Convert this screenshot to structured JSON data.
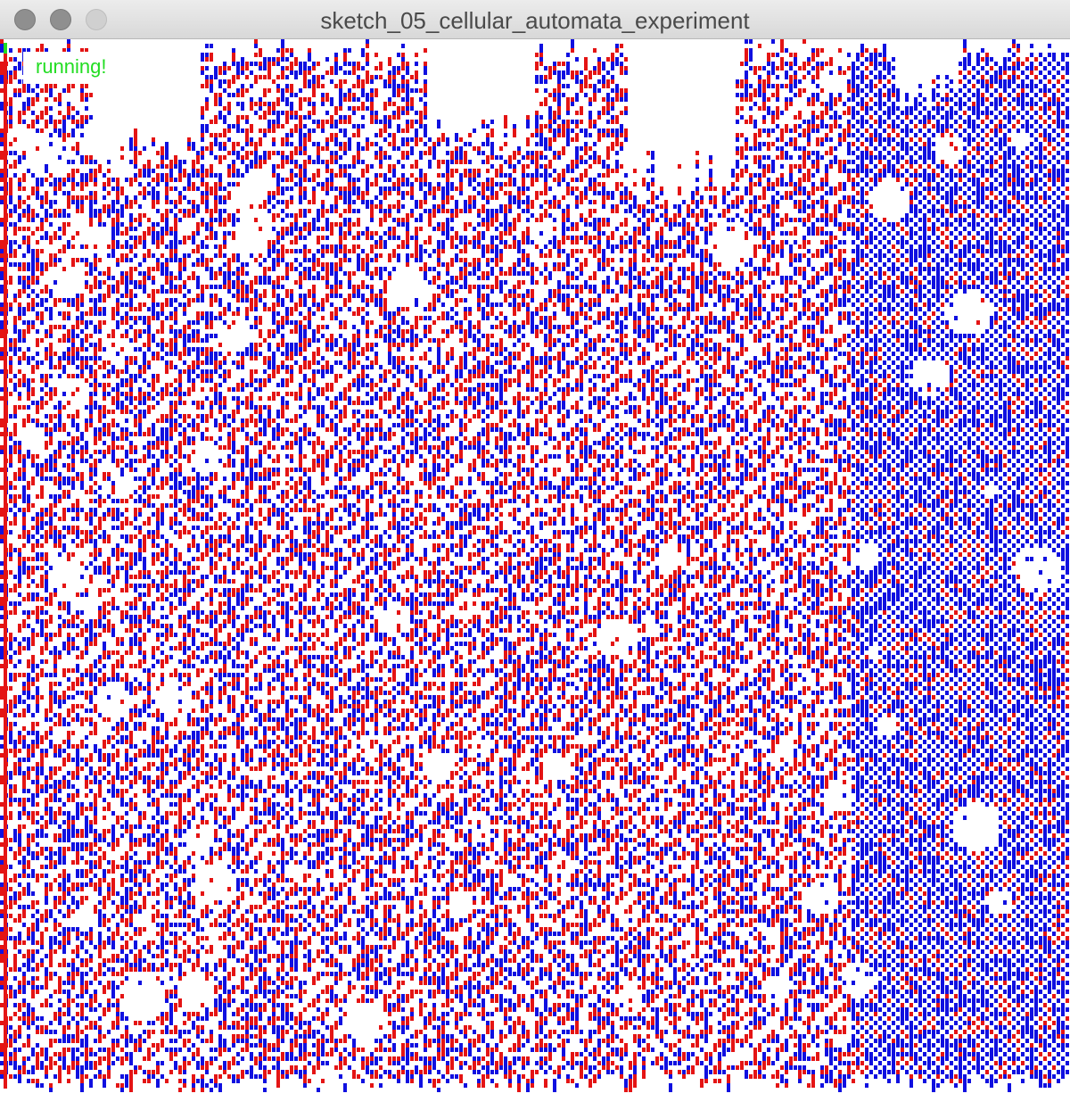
{
  "window": {
    "title": "sketch_05_cellular_automata_experiment"
  },
  "status": {
    "text": "running!",
    "color": "#22dd22"
  },
  "automaton": {
    "palette": {
      "background": "#ffffff",
      "state_a": "#e41414",
      "state_b": "#1010e0"
    }
  }
}
